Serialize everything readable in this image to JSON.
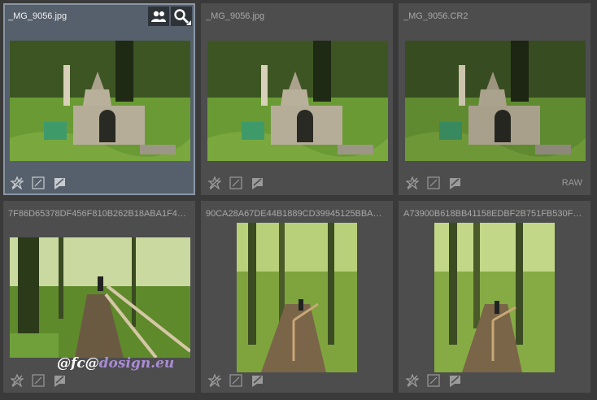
{
  "cells": [
    {
      "filename": "_MG_9056.jpg",
      "badge": "",
      "scene": "fountain"
    },
    {
      "filename": "_MG_9056.jpg",
      "badge": "",
      "scene": "fountain"
    },
    {
      "filename": "_MG_9056.CR2",
      "badge": "RAW",
      "scene": "fountain"
    },
    {
      "filename": "7F86D65378DF456F810B262B18ABA1F4…",
      "badge": "",
      "scene": "stairs-wide"
    },
    {
      "filename": "90CA28A67DE44B1889CD39945125BBA…",
      "badge": "",
      "scene": "stairs-tall"
    },
    {
      "filename": "A73900B618BB41158EDBF2B751FB530F…",
      "badge": "",
      "scene": "stairs-tall"
    }
  ],
  "hover_buttons": {
    "people": "people-icon",
    "search": "search-icon"
  },
  "watermark": {
    "part1": "@",
    "part2": "fc",
    "part3": "@",
    "part4": "dosign.eu"
  },
  "colors": {
    "selected_border": "#8a96a4",
    "cell_bg": "#4d4d4d",
    "background": "#3a3a3a"
  }
}
